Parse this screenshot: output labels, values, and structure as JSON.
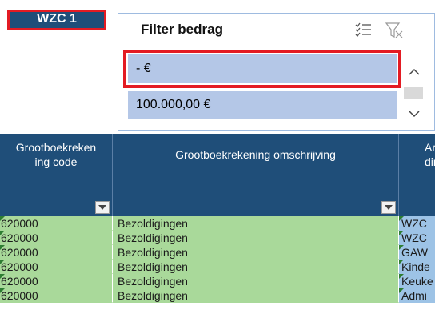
{
  "badge": {
    "label": "WZC 1"
  },
  "slicer": {
    "title": "Filter bedrag",
    "items": [
      {
        "label": "-   €"
      },
      {
        "label": "100.000,00 €"
      }
    ],
    "icons": [
      "multi-select-icon",
      "clear-filter-icon",
      "chevron-up-icon",
      "chevron-down-icon"
    ]
  },
  "table": {
    "headers": {
      "code": "Grootboekreken ing code",
      "code_line1": "Grootboekreken",
      "code_line2": "ing code",
      "desc": "Grootboekrekening omschrijving",
      "extra_line1": "Ar",
      "extra_line2": "dir"
    },
    "rows": [
      {
        "code": "620000",
        "desc": "Bezoldigingen",
        "extra": "WZC"
      },
      {
        "code": "620000",
        "desc": "Bezoldigingen",
        "extra": "WZC"
      },
      {
        "code": "620000",
        "desc": "Bezoldigingen",
        "extra": "GAW"
      },
      {
        "code": "620000",
        "desc": "Bezoldigingen",
        "extra": "Kinde"
      },
      {
        "code": "620000",
        "desc": "Bezoldigingen",
        "extra": "Keuke"
      },
      {
        "code": "620000",
        "desc": "Bezoldigingen",
        "extra": "Admi"
      }
    ]
  },
  "colors": {
    "header_bg": "#1f4e79",
    "highlight_border": "#e31b23",
    "slicer_item_bg": "#b4c7e7",
    "row_green": "#a9d99a",
    "row_blue": "#9dc3e6"
  }
}
